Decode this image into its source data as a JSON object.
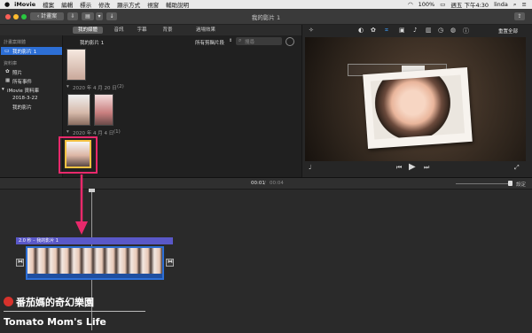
{
  "menubar": {
    "app_name": "iMovie",
    "items": [
      "檔案",
      "編輯",
      "標示",
      "修改",
      "顯示方式",
      "視窗",
      "輔助說明"
    ],
    "clock": "週五 下午4:30",
    "user": "linda",
    "battery": "100%"
  },
  "toolbar": {
    "back_label": "計畫案",
    "window_title": "我的影片 1"
  },
  "tabs": [
    {
      "label": "我的媒體",
      "active": true
    },
    {
      "label": "音訊",
      "active": false
    },
    {
      "label": "字幕",
      "active": false
    },
    {
      "label": "背景",
      "active": false
    },
    {
      "label": "過場效果",
      "active": false
    }
  ],
  "sidebar": {
    "section1_header": "計畫案媒體",
    "project_item": "我的影片 1",
    "section2_header": "資料庫",
    "photos": "照片",
    "all_events": "所有事件",
    "library": "iMovie 資料庫",
    "event_date": "2018-3-22",
    "event_item": "我的影片"
  },
  "browser": {
    "title": "我的影片 1",
    "filter": "所有剪輯片段",
    "search_placeholder": "搜尋",
    "group1_label": "2020 年 4 月 20 日",
    "group1_count": "(2)",
    "group2_label": "2020 年 4 月 4 日",
    "group2_count": "(1)"
  },
  "viewer": {
    "reset_label": "重置全部"
  },
  "timeline": {
    "current_time": "00:01",
    "total_time": "00:04",
    "settings_label": "設定",
    "title_clip": "2.0 秒 – 我的影片 1"
  },
  "watermark": {
    "line1": "番茄媽的奇幻樂園",
    "line2": "Tomato Mom's Life"
  },
  "colors": {
    "accent": "#2d6fd6",
    "arrow": "#e8296b",
    "title_bar": "#5a58c8",
    "clip_border": "#2d6fd6"
  }
}
